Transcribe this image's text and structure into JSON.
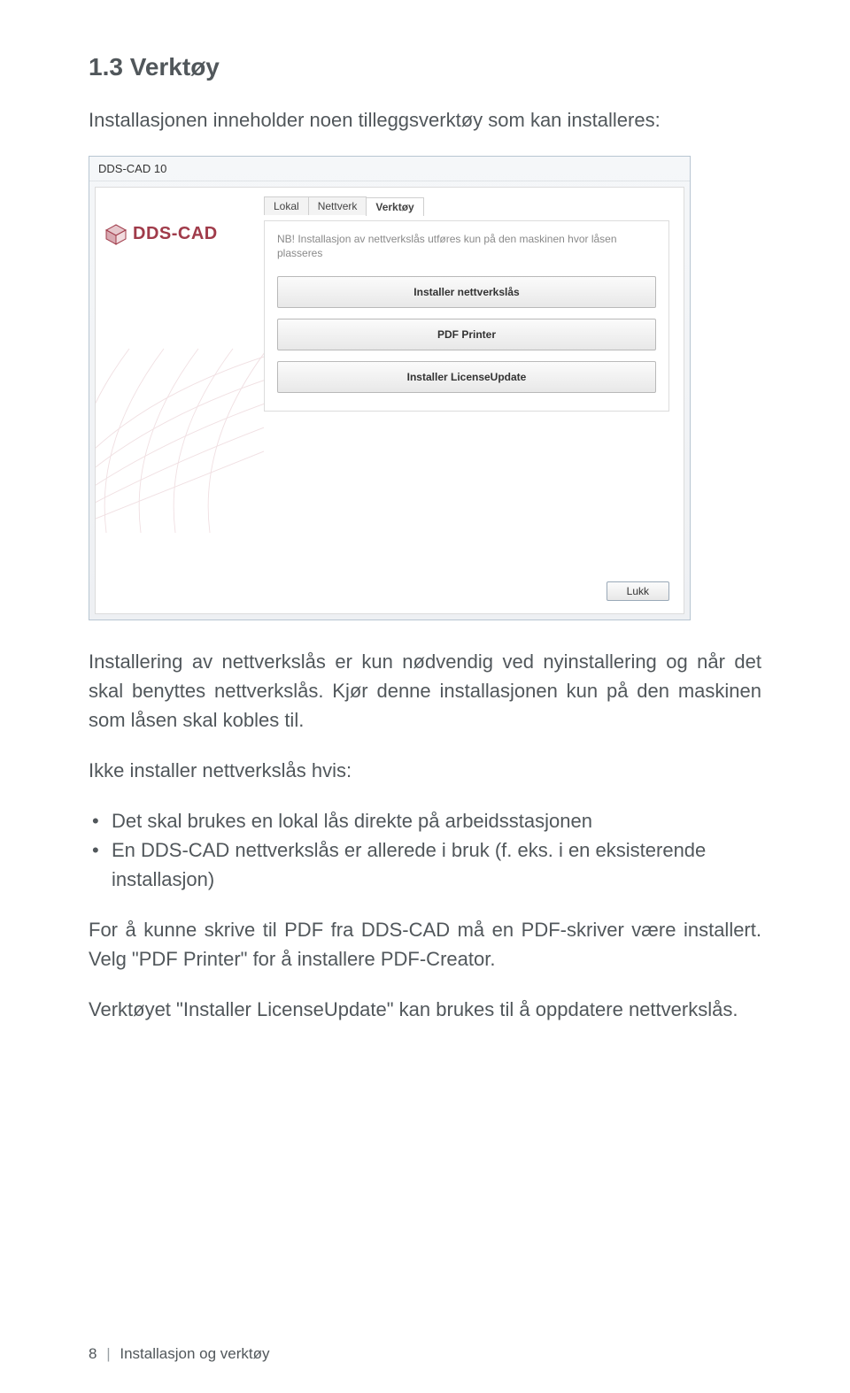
{
  "section": {
    "heading": "1.3 Verktøy",
    "intro": "Installasjonen inneholder noen tilleggsverktøy som kan installeres:"
  },
  "dialog": {
    "title": "DDS-CAD 10",
    "brand": "DDS-CAD",
    "tabs": {
      "lokal": "Lokal",
      "nettverk": "Nettverk",
      "verktoy": "Verktøy"
    },
    "notice": "NB! Installasjon av nettverkslås utføres kun på den maskinen hvor låsen plasseres",
    "buttons": {
      "install_netlock": "Installer nettverkslås",
      "pdf_printer": "PDF Printer",
      "install_licupdate": "Installer LicenseUpdate"
    },
    "close": "Lukk"
  },
  "body": {
    "p1": "Installering av nettverkslås er kun nødvendig ved nyinstallering og når det skal benyttes nettverkslås. Kjør denne installasjonen kun på den maskinen som låsen skal kobles til.",
    "p2": "Ikke installer nettverkslås hvis:",
    "bullets": [
      "Det skal brukes en lokal lås direkte på arbeidsstasjonen",
      "En DDS-CAD nettverkslås er allerede i bruk (f. eks. i en eksisterende installasjon)"
    ],
    "p3": "For å kunne skrive til PDF fra DDS-CAD må en PDF-skriver være installert. Velg \"PDF Printer\" for å installere PDF-Creator.",
    "p4": "Verktøyet \"Installer LicenseUpdate\" kan brukes til å oppdatere nettverkslås."
  },
  "footer": {
    "page": "8",
    "title": "Installasjon og verktøy"
  }
}
